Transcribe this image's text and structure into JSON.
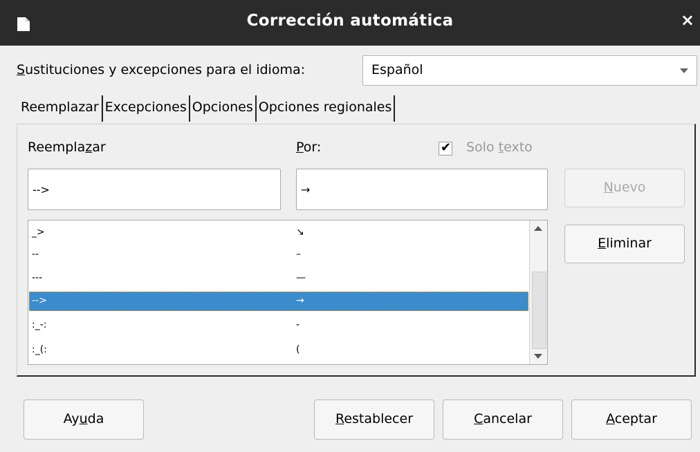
{
  "window": {
    "title": "Corrección automática",
    "close_glyph": "×"
  },
  "language": {
    "label_prefix": "S",
    "label_rest": "ustituciones y excepciones para el idioma:",
    "selected": "Español"
  },
  "tabs": [
    {
      "label": "Reemplazar",
      "active": true
    },
    {
      "label": "Excepciones",
      "active": false
    },
    {
      "label": "Opciones",
      "active": false
    },
    {
      "label": "Opciones regionales",
      "active": false
    }
  ],
  "replace_tab": {
    "replace_label_a": "Reempla",
    "replace_label_u": "z",
    "replace_label_b": "ar",
    "with_label_u": "P",
    "with_label_b": "or:",
    "text_only_a": "Solo ",
    "text_only_u": "t",
    "text_only_b": "exto",
    "text_only_checked": true,
    "replace_value": "-->",
    "with_value": "→",
    "entries": [
      {
        "from": "_>",
        "to": "↘"
      },
      {
        "from": "--",
        "to": "–"
      },
      {
        "from": "---",
        "to": "—"
      },
      {
        "from": "-->",
        "to": "→"
      },
      {
        "from": ":_-:",
        "to": "-"
      },
      {
        "from": ":_(:",
        "to": "("
      }
    ],
    "selected_index": 3,
    "new_button_u": "N",
    "new_button_b": "uevo",
    "delete_button_u": "E",
    "delete_button_b": "liminar"
  },
  "footer": {
    "help_a": "Ay",
    "help_u": "u",
    "help_b": "da",
    "reset_u": "R",
    "reset_b": "establecer",
    "cancel_u": "C",
    "cancel_b": "ancelar",
    "ok_u": "A",
    "ok_b": "ceptar"
  },
  "colors": {
    "titlebar": "#2b2b2b",
    "selection": "#3c8ccb",
    "dialog_bg": "#efefef"
  }
}
